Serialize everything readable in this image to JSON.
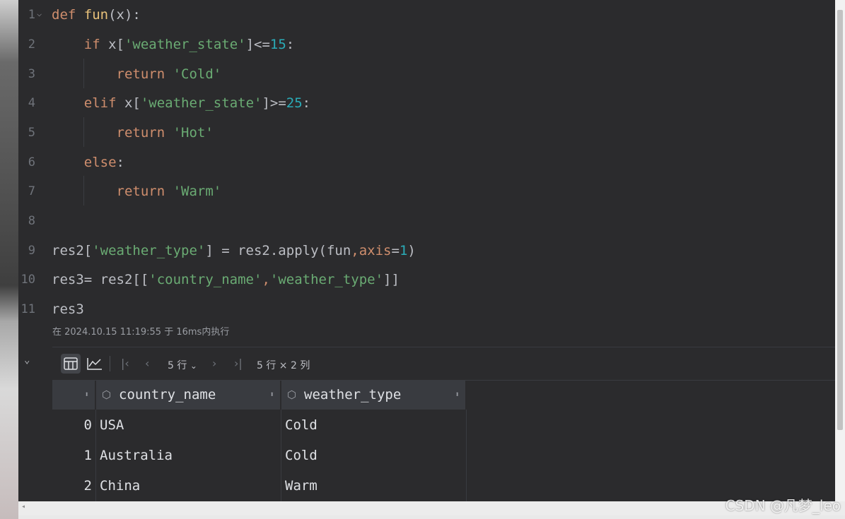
{
  "editor": {
    "line_numbers": [
      "1",
      "2",
      "3",
      "4",
      "5",
      "6",
      "7",
      "8",
      "9",
      "10",
      "11"
    ],
    "lines": [
      {
        "tokens": [
          {
            "t": "def ",
            "c": "kw"
          },
          {
            "t": "fun",
            "c": "fn"
          },
          {
            "t": "(x):",
            "c": ""
          }
        ]
      },
      {
        "tokens": [
          {
            "t": "    ",
            "c": ""
          },
          {
            "t": "if ",
            "c": "kw"
          },
          {
            "t": "x[",
            "c": ""
          },
          {
            "t": "'weather_state'",
            "c": "str"
          },
          {
            "t": "]<=",
            "c": ""
          },
          {
            "t": "15",
            "c": "num"
          },
          {
            "t": ":",
            "c": ""
          }
        ]
      },
      {
        "tokens": [
          {
            "t": "        ",
            "c": ""
          },
          {
            "t": "return ",
            "c": "kw"
          },
          {
            "t": "'Cold'",
            "c": "str"
          }
        ]
      },
      {
        "tokens": [
          {
            "t": "    ",
            "c": ""
          },
          {
            "t": "elif ",
            "c": "kw"
          },
          {
            "t": "x[",
            "c": ""
          },
          {
            "t": "'weather_state'",
            "c": "str"
          },
          {
            "t": "]>=",
            "c": ""
          },
          {
            "t": "25",
            "c": "num"
          },
          {
            "t": ":",
            "c": ""
          }
        ]
      },
      {
        "tokens": [
          {
            "t": "        ",
            "c": ""
          },
          {
            "t": "return ",
            "c": "kw"
          },
          {
            "t": "'Hot'",
            "c": "str"
          }
        ]
      },
      {
        "tokens": [
          {
            "t": "    ",
            "c": ""
          },
          {
            "t": "else",
            "c": "kw"
          },
          {
            "t": ":",
            "c": ""
          }
        ]
      },
      {
        "tokens": [
          {
            "t": "        ",
            "c": ""
          },
          {
            "t": "return ",
            "c": "kw"
          },
          {
            "t": "'Warm'",
            "c": "str"
          }
        ]
      },
      {
        "tokens": []
      },
      {
        "tokens": [
          {
            "t": "res2[",
            "c": ""
          },
          {
            "t": "'weather_type'",
            "c": "str"
          },
          {
            "t": "] = res2.apply(fun",
            "c": ""
          },
          {
            "t": ",",
            "c": "kw"
          },
          {
            "t": "axis",
            "c": "param"
          },
          {
            "t": "=",
            "c": ""
          },
          {
            "t": "1",
            "c": "num"
          },
          {
            "t": ")",
            "c": ""
          }
        ]
      },
      {
        "tokens": [
          {
            "t": "res3= res2[[",
            "c": ""
          },
          {
            "t": "'country_name'",
            "c": "str"
          },
          {
            "t": ",",
            "c": "kw"
          },
          {
            "t": "'weather_type'",
            "c": "str"
          },
          {
            "t": "]]",
            "c": ""
          }
        ]
      },
      {
        "tokens": [
          {
            "t": "res3",
            "c": ""
          }
        ]
      }
    ]
  },
  "execution": {
    "meta": "在 2024.10.15 11:19:55 于 16ms内执行"
  },
  "output": {
    "toolbar": {
      "rows_label": "5 行",
      "shape_label": "5 行 × 2 列"
    },
    "table": {
      "columns": [
        "country_name",
        "weather_type"
      ],
      "rows": [
        {
          "index": "0",
          "country_name": "USA",
          "weather_type": "Cold"
        },
        {
          "index": "1",
          "country_name": "Australia",
          "weather_type": "Cold"
        },
        {
          "index": "2",
          "country_name": "China",
          "weather_type": "Warm"
        }
      ]
    }
  },
  "watermark": "CSDN @凡梦_leo"
}
